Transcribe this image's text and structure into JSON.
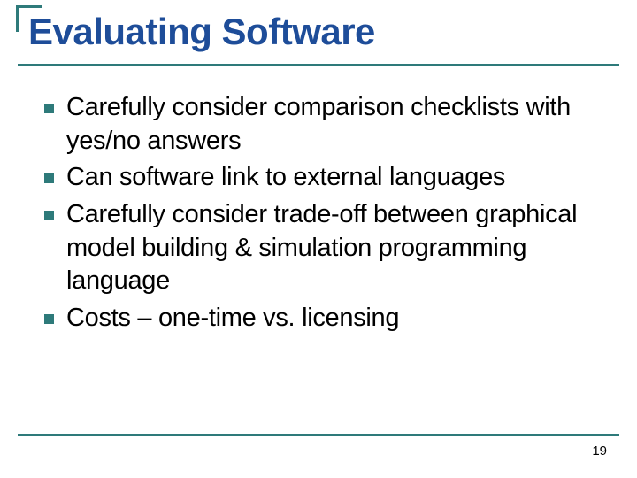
{
  "slide": {
    "title": "Evaluating Software",
    "bullets": [
      "Carefully consider comparison checklists with yes/no answers",
      "Can software link to external languages",
      "Carefully consider trade-off between graphical model building & simulation programming language",
      "Costs – one-time vs. licensing"
    ],
    "page_number": "19",
    "colors": {
      "title": "#1e4d99",
      "accent": "#2e7a7a",
      "text": "#000000"
    }
  }
}
